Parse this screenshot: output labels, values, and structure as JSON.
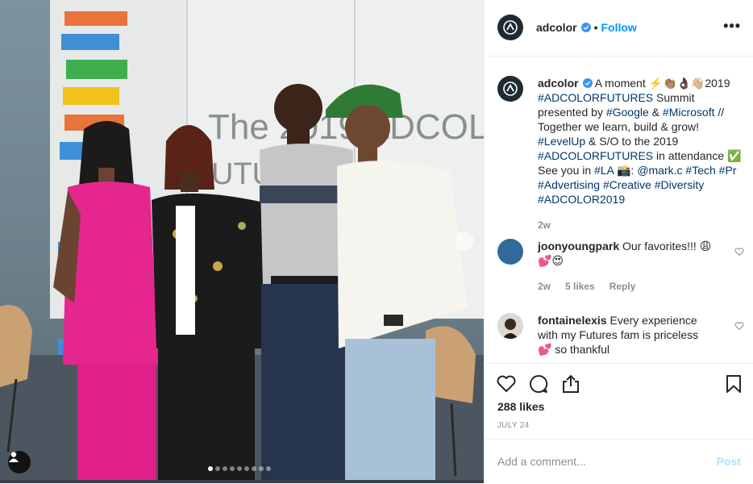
{
  "account": {
    "username": "adcolor",
    "follow_label": "Follow",
    "separator": "•",
    "more": "•••"
  },
  "caption": {
    "username": "adcolor",
    "parts": [
      {
        "t": "A moment ⚡️👏🏽👌🏿👋🏼2019 "
      },
      {
        "t": "#ADCOLORFUTURES",
        "link": true
      },
      {
        "t": " Summit presented by "
      },
      {
        "t": "#Google",
        "link": true
      },
      {
        "t": " & "
      },
      {
        "t": "#Microsoft",
        "link": true
      },
      {
        "t": " // Together we learn, build & grow! "
      },
      {
        "t": "#LevelUp",
        "link": true
      },
      {
        "t": " & S/O to the 2019 "
      },
      {
        "t": "#ADCOLORFUTURES",
        "link": true
      },
      {
        "t": " in attendance ✅ See you in "
      },
      {
        "t": "#LA",
        "link": true
      },
      {
        "t": " 📸: "
      },
      {
        "t": "@mark.c",
        "link": true
      },
      {
        "t": " "
      },
      {
        "t": "#Tech",
        "link": true
      },
      {
        "t": " "
      },
      {
        "t": "#Pr",
        "link": true
      },
      {
        "t": " "
      },
      {
        "t": "#Advertising",
        "link": true
      },
      {
        "t": " "
      },
      {
        "t": "#Creative",
        "link": true
      },
      {
        "t": " "
      },
      {
        "t": "#Diversity",
        "link": true
      },
      {
        "t": " "
      },
      {
        "t": "#ADCOLOR2019",
        "link": true
      }
    ],
    "time": "2w"
  },
  "comments": [
    {
      "username": "joonyoungpark",
      "text": "Our favorites!!! 😩💕😍",
      "time": "2w",
      "likes": "5 likes",
      "reply": "Reply"
    },
    {
      "username": "fontainelexis",
      "text": "Every experience with my Futures fam is priceless 💕 so thankful"
    }
  ],
  "likes_count": "288 likes",
  "post_date": "JULY 24",
  "add_comment": {
    "placeholder": "Add a comment...",
    "post_label": "Post"
  },
  "photo": {
    "backdrop_text_1": "The 2019 ADCOL",
    "backdrop_text_2": "UTURES Summ",
    "carousel_count": 9,
    "carousel_active": 0
  },
  "colors": {
    "accent": "#0095f6",
    "link": "#00376b",
    "muted": "#8e8e8e",
    "border": "#efefef"
  }
}
